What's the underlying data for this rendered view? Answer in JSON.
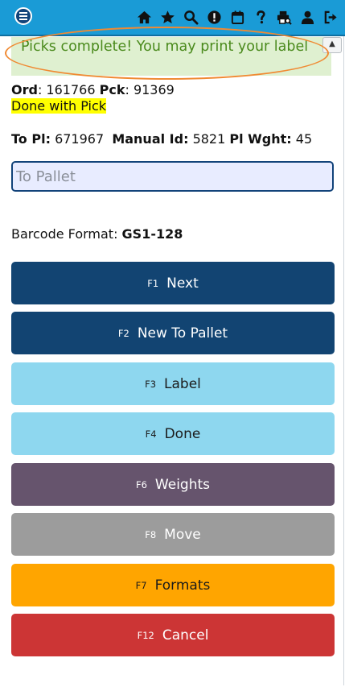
{
  "header": {
    "icons": [
      "menu-icon",
      "home-icon",
      "star-icon",
      "search-icon",
      "alert-icon",
      "calendar-icon",
      "help-icon",
      "search-printer-icon",
      "user-icon",
      "logout-icon"
    ]
  },
  "alert": {
    "message": "Picks complete! You may print your label",
    "close_label": "▲"
  },
  "order": {
    "ord_label": "Ord",
    "ord_value": ": 161766",
    "pck_label": "Pck",
    "pck_value": ": 91369",
    "status": "Done with Pick"
  },
  "pallet_info": {
    "to_pl_label": "To Pl:",
    "to_pl_value": "671967",
    "manual_id_label": "Manual Id:",
    "manual_id_value": "5821",
    "pl_wght_label": "Pl Wght:",
    "pl_wght_value": "45"
  },
  "to_pallet_input": {
    "placeholder": "To Pallet",
    "value": ""
  },
  "barcode": {
    "label": "Barcode Format:",
    "value": "GS1-128"
  },
  "buttons": [
    {
      "key": "F1",
      "label": "Next",
      "color": "#124472"
    },
    {
      "key": "F2",
      "label": "New To Pallet",
      "color": "#124472"
    },
    {
      "key": "F3",
      "label": "Label",
      "color": "#8ed7ef"
    },
    {
      "key": "F4",
      "label": "Done",
      "color": "#8ed7ef"
    },
    {
      "key": "F6",
      "label": "Weights",
      "color": "#66546d"
    },
    {
      "key": "F8",
      "label": "Move",
      "color": "#9c9c9c"
    },
    {
      "key": "F7",
      "label": "Formats",
      "color": "#ffa500"
    },
    {
      "key": "F12",
      "label": "Cancel",
      "color": "#cc3535"
    }
  ]
}
